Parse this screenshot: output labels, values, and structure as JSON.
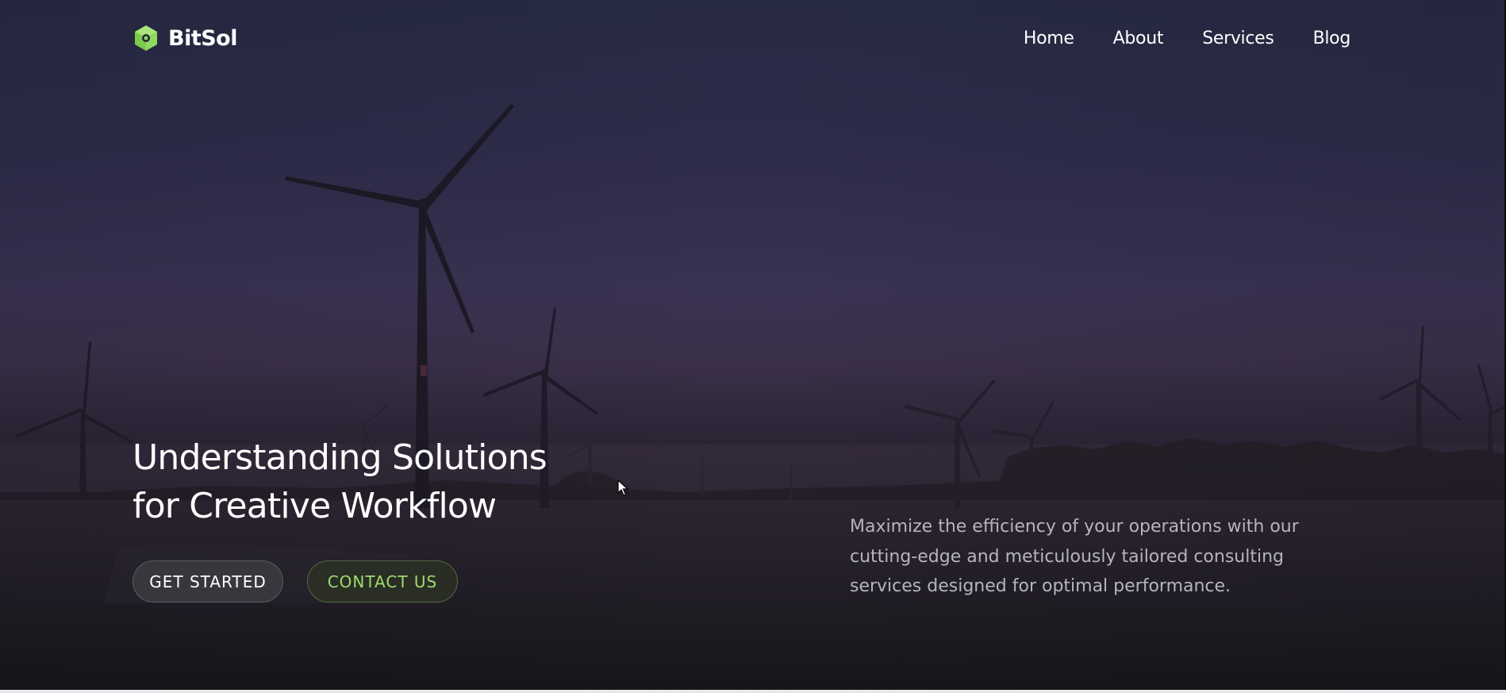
{
  "brand": {
    "name": "BitSol",
    "icon": "cube-icon",
    "accent": "#8fd85f"
  },
  "nav": {
    "items": [
      {
        "label": "Home"
      },
      {
        "label": "About"
      },
      {
        "label": "Services"
      },
      {
        "label": "Blog"
      }
    ]
  },
  "hero": {
    "headline_line1": "Understanding Solutions",
    "headline_line2": "for Creative Workflow",
    "primary_button": "GET STARTED",
    "secondary_button": "CONTACT US",
    "description": "Maximize the efficiency of your operations with our cutting-edge and meticulously tailored consulting services designed for optimal performance.",
    "background_image": "wind-turbines-dusk"
  },
  "colors": {
    "accent_green": "#9fdc6f",
    "text_primary": "#ffffff",
    "text_muted": "#b6b4bf"
  }
}
